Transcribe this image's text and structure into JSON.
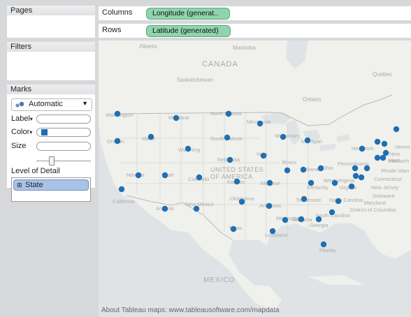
{
  "panels": {
    "pages_title": "Pages",
    "filters_title": "Filters",
    "marks_title": "Marks"
  },
  "marks": {
    "mark_type": "Automatic",
    "label": "Label",
    "color": "Color",
    "size": "Size",
    "lod_title": "Level of Detail",
    "lod_field": "State",
    "mark_color": "#1f6fb2"
  },
  "shelves": {
    "columns_label": "Columns",
    "columns_pill": "Longitude (generat..",
    "rows_label": "Rows",
    "rows_pill": "Latitude (generated)"
  },
  "map": {
    "credit": "About Tableau maps: www.tableausoftware.com/mapdata",
    "labels": {
      "canada": "CANADA",
      "united_states": "UNITED STATES",
      "united_states_2": "OF AMERICA",
      "mexico": "MEXICO",
      "alberta": "Alberta",
      "manitoba": "Manitoba",
      "saskatchewan": "Saskatchewan",
      "ontario": "Ontario",
      "quebec": "Quebec",
      "washington": "Washington",
      "oregon": "Oregon",
      "idaho": "Idaho",
      "montana": "Montana",
      "wyoming": "Wyoming",
      "nevada": "Nevada",
      "utah": "Utah",
      "colorado": "Colorado",
      "california": "California",
      "arizona": "Arizona",
      "new_mexico": "New Mexico",
      "north_dakota": "North Dakota",
      "south_dakota": "South Dakota",
      "nebraska": "Nebraska",
      "kansas": "Kansas",
      "oklahoma": "Oklahoma",
      "texas": "Texas",
      "minnesota": "Minnesota",
      "iowa": "Iowa",
      "missouri": "Missouri",
      "arkansas": "Arkansas",
      "louisiana": "Louisiana",
      "wisconsin": "Wisconsin",
      "illinois": "Illinois",
      "michigan": "Michigan",
      "indiana": "Indiana",
      "ohio": "Ohio",
      "kentucky": "Kentucky",
      "tennessee": "Tennessee",
      "mississippi": "Mississippi",
      "alabama": "Alabama",
      "georgia": "Georgia",
      "florida": "Florida",
      "south_carolina": "South Carolina",
      "north_carolina": "North Carolina",
      "virginia": "Virginia",
      "west_virginia": "West Virginia",
      "pennsylvania": "Pennsylvania",
      "new_york": "New York",
      "vermont": "Vermo",
      "new_hampshire": "New Ham",
      "massachusetts": "Massach",
      "rhode_island": "Rhode Islan",
      "connecticut": "Connecticut",
      "new_jersey": "New Jersey",
      "delaware": "Delaware",
      "maryland": "Maryland",
      "dc": "District of Columbia"
    }
  }
}
